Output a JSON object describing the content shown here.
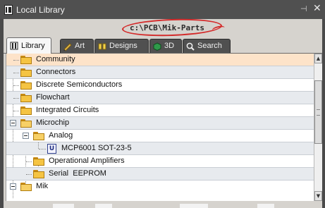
{
  "window": {
    "title": "Local Library",
    "pin_icon": "pin-icon",
    "close_icon": "close-icon"
  },
  "path": {
    "label": "c:\\PCB\\Mik-Parts"
  },
  "tabs": [
    {
      "label": "Library",
      "icon": "library-icon"
    },
    {
      "label": "Art",
      "icon": "art-icon"
    },
    {
      "label": "Designs",
      "icon": "designs-icon"
    },
    {
      "label": "3D",
      "icon": "3d-icon"
    },
    {
      "label": "Search",
      "icon": "search-icon"
    }
  ],
  "tree": {
    "items": [
      {
        "label": "Community"
      },
      {
        "label": "Connectors"
      },
      {
        "label": "Discrete Semiconductors"
      },
      {
        "label": "Flowchart"
      },
      {
        "label": "Integrated Circuits"
      },
      {
        "label": "Microchip"
      },
      {
        "label": "Analog"
      },
      {
        "label": "MCP6001 SOT-23-5",
        "icon_text": "U"
      },
      {
        "label": "Operational Amplifiers"
      },
      {
        "label": "Serial  EEPROM"
      },
      {
        "label": "Mik"
      }
    ]
  },
  "colors": {
    "selected_row": "#fde3c9",
    "alt_row": "#e7eaee",
    "annotation": "#d42a2a",
    "folder": "#f5c443"
  }
}
